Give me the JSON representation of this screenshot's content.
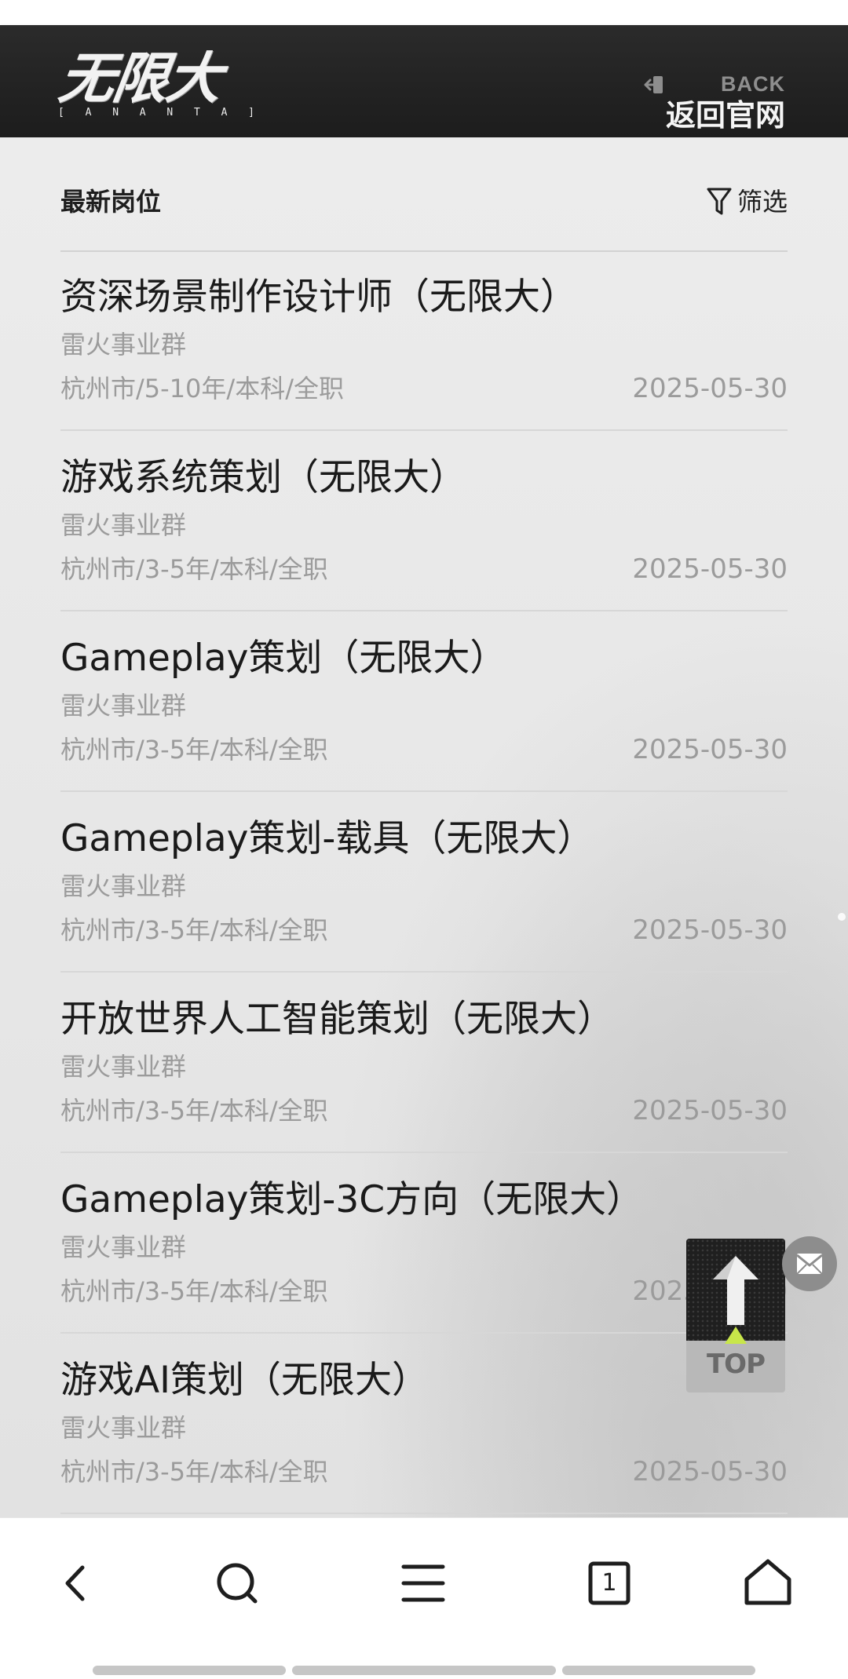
{
  "header": {
    "logo_main": "无限大",
    "logo_sub": [
      "[",
      "A",
      "N",
      "A",
      "N",
      "T",
      "A",
      "]"
    ],
    "back_en": "BACK",
    "back_cn": "返回官网"
  },
  "list": {
    "title": "最新岗位",
    "filter_label": "筛选"
  },
  "jobs": [
    {
      "title": "资深场景制作设计师（无限大）",
      "dept": "雷火事业群",
      "meta": "杭州市/5-10年/本科/全职",
      "date": "2025-05-30"
    },
    {
      "title": "游戏系统策划（无限大）",
      "dept": "雷火事业群",
      "meta": "杭州市/3-5年/本科/全职",
      "date": "2025-05-30"
    },
    {
      "title": "Gameplay策划（无限大）",
      "dept": "雷火事业群",
      "meta": "杭州市/3-5年/本科/全职",
      "date": "2025-05-30"
    },
    {
      "title": "Gameplay策划-载具（无限大）",
      "dept": "雷火事业群",
      "meta": "杭州市/3-5年/本科/全职",
      "date": "2025-05-30"
    },
    {
      "title": "开放世界人工智能策划（无限大）",
      "dept": "雷火事业群",
      "meta": "杭州市/3-5年/本科/全职",
      "date": "2025-05-30"
    },
    {
      "title": "Gameplay策划-3C方向（无限大）",
      "dept": "雷火事业群",
      "meta": "杭州市/3-5年/本科/全职",
      "date": "2025-05-30"
    },
    {
      "title": "游戏AI策划（无限大）",
      "dept": "雷火事业群",
      "meta": "杭州市/3-5年/本科/全职",
      "date": "2025-05-30"
    }
  ],
  "floating": {
    "top_label": "TOP"
  },
  "browser": {
    "tab_count": "1"
  },
  "colors": {
    "header_bg": "#222222",
    "page_bg": "#e7e7e7",
    "title_text": "#1a1a1a",
    "secondary_text": "#9b9b9b",
    "top_accent": "#c8e64a"
  },
  "icons": {
    "back": "exit-door-icon",
    "filter": "funnel-icon",
    "message": "mail-icon",
    "nav_back": "chevron-left-icon",
    "nav_search": "search-icon",
    "nav_menu": "hamburger-menu-icon",
    "nav_tabs": "tabs-icon",
    "nav_home": "home-icon"
  }
}
